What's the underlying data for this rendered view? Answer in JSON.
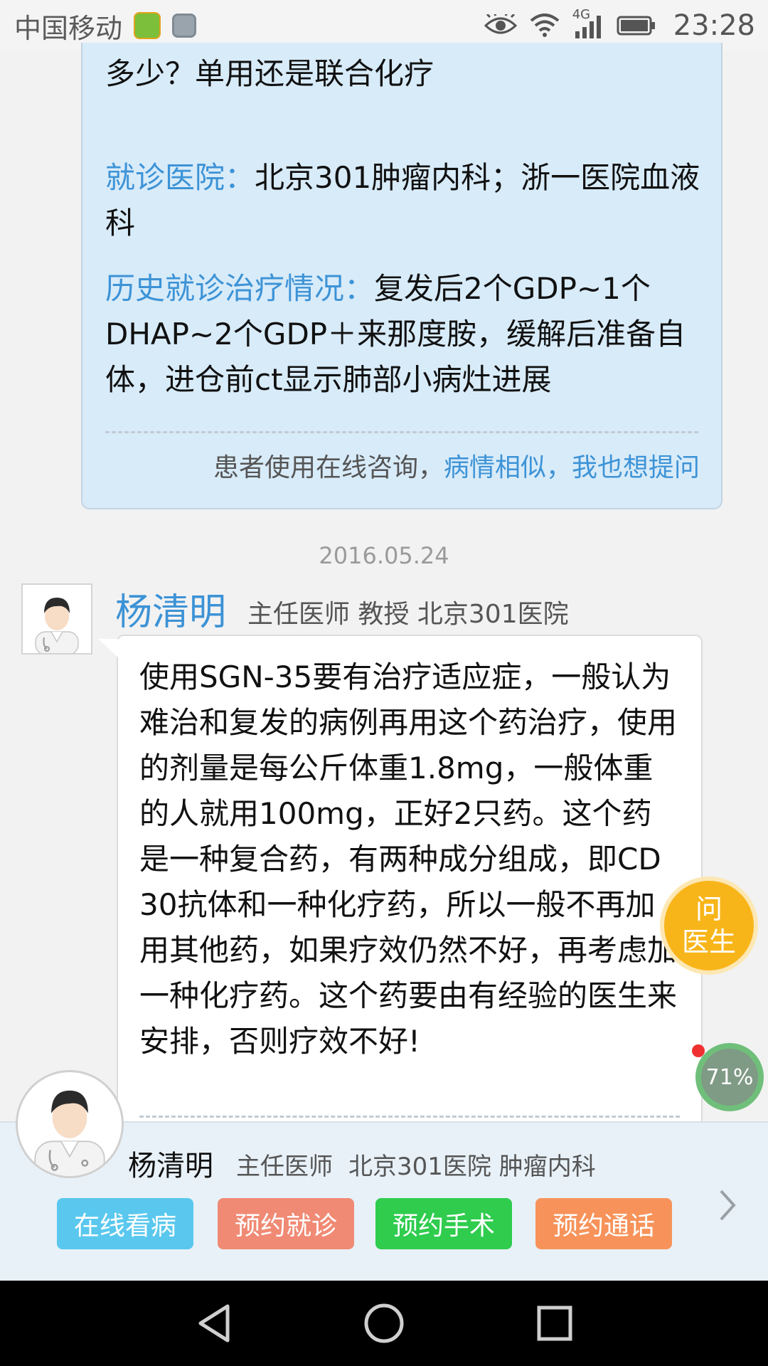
{
  "status_bar": {
    "carrier": "中国移动",
    "network": "4G",
    "time": "23:28",
    "icons": [
      "app-icon",
      "gallery-icon",
      "eye-icon",
      "wifi-icon",
      "signal-icon",
      "battery-icon"
    ]
  },
  "question": {
    "line1": "多少？单用还是联合化疗",
    "hospital_label": "就诊医院：",
    "hospital_value": "北京301肿瘤内科；浙一医院血液科",
    "history_label": "历史就诊治疗情况：",
    "history_value": "复发后2个GDP~1个DHAP~2个GDP＋来那度胺，缓解后准备自体，进仓前ct显示肺部小病灶进展",
    "footer_text": "患者使用在线咨询，",
    "footer_link": "病情相似，我也想提问"
  },
  "date": "2016.05.24",
  "reply": {
    "doctor_name": "杨清明",
    "doctor_meta": "主任医师 教授 北京301医院",
    "text": "使用SGN-35要有治疗适应症，一般认为难治和复发的病例再用这个药治疗，使用的剂量是每公斤体重1.8mg，一般体重的人就用100mg，正好2只药。这个药是一种复合药，有两种成分组成，即CD30抗体和一种化疗药，所以一般不再加用其他药，如果疗效仍然不好，再考虑加一种化疗药。这个药要由有经验的医生来安排，否则疗效不好!"
  },
  "floating": {
    "ask_line1": "问",
    "ask_line2": "医生",
    "percent": "71%"
  },
  "doctor_bar": {
    "name": "杨清明",
    "title": "主任医师",
    "hospital": "北京301医院 肿瘤内科",
    "actions": [
      "在线看病",
      "预约就诊",
      "预约手术",
      "预约通话"
    ],
    "colors": {
      "online": "#5ac8ee",
      "visit": "#f08a74",
      "surgery": "#2fcc4e",
      "call": "#f7935a"
    }
  },
  "navbar": {
    "icons": [
      "back-icon",
      "home-icon",
      "recents-icon"
    ]
  },
  "accent_color": "#3d93d6"
}
